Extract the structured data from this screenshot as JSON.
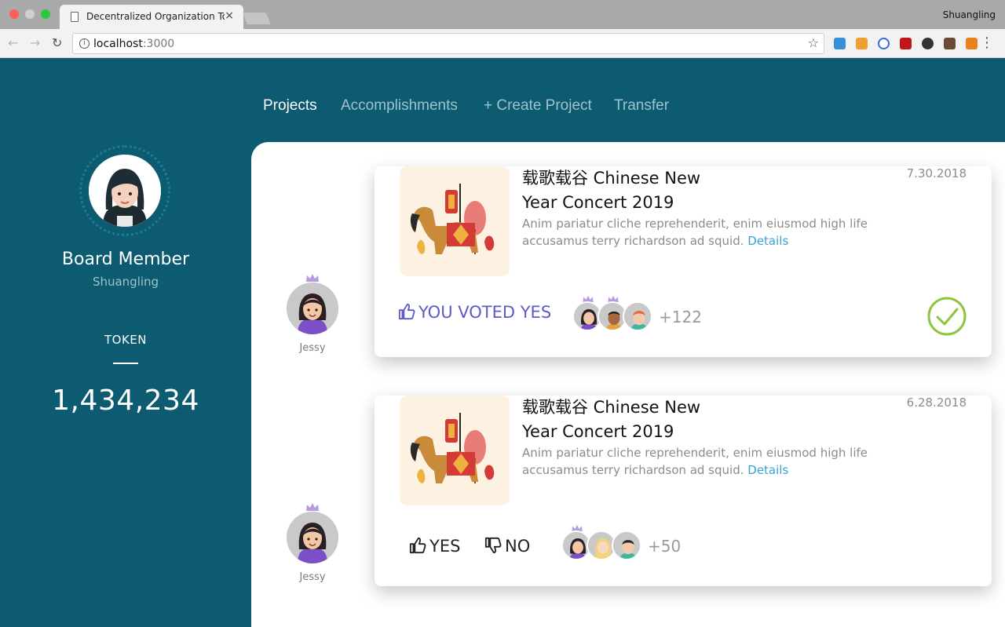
{
  "browser": {
    "tab_title": "Decentralized Organization To",
    "tab_close": "×",
    "profile_name": "Shuangling",
    "url_host": "localhost",
    "url_port": ":3000",
    "nav_back": "←",
    "nav_forward": "→",
    "reload": "↻",
    "bookmark_icon": "☆",
    "menu_icon": "⋮",
    "info_icon": "i"
  },
  "nav": {
    "items": [
      {
        "label": "Projects",
        "active": true
      },
      {
        "label": "Accomplishments",
        "active": false
      },
      {
        "label": "+ Create Project",
        "active": false
      },
      {
        "label": "Transfer",
        "active": false
      }
    ]
  },
  "sidebar": {
    "role": "Board Member",
    "name": "Shuangling",
    "token_label": "TOKEN",
    "token_value": "1,434,234"
  },
  "cards": [
    {
      "proposer": "Jessy",
      "title_line1": "载歌载谷 Chinese New",
      "title_line2": "Year Concert 2019",
      "desc": "Anim pariatur cliche reprehenderit, enim eiusmod high life accusamus terry richardson ad squid.",
      "details_label": "Details",
      "date": "7.30.2018",
      "vote_status": "YOU VOTED YES",
      "voter_count": "+122",
      "voted": true
    },
    {
      "proposer": "Jessy",
      "title_line1": "载歌载谷 Chinese New",
      "title_line2": "Year Concert 2019",
      "desc": "Anim pariatur cliche reprehenderit, enim eiusmod high life accusamus terry richardson ad squid.",
      "details_label": "Details",
      "date": "6.28.2018",
      "yes_label": "YES",
      "no_label": "NO",
      "voter_count": "+50",
      "voted": false
    }
  ],
  "colors": {
    "sidebar_bg": "#0c5b70",
    "accent_vote": "#5b5cc4",
    "link": "#3aa3d6",
    "check": "#8cc63f"
  }
}
